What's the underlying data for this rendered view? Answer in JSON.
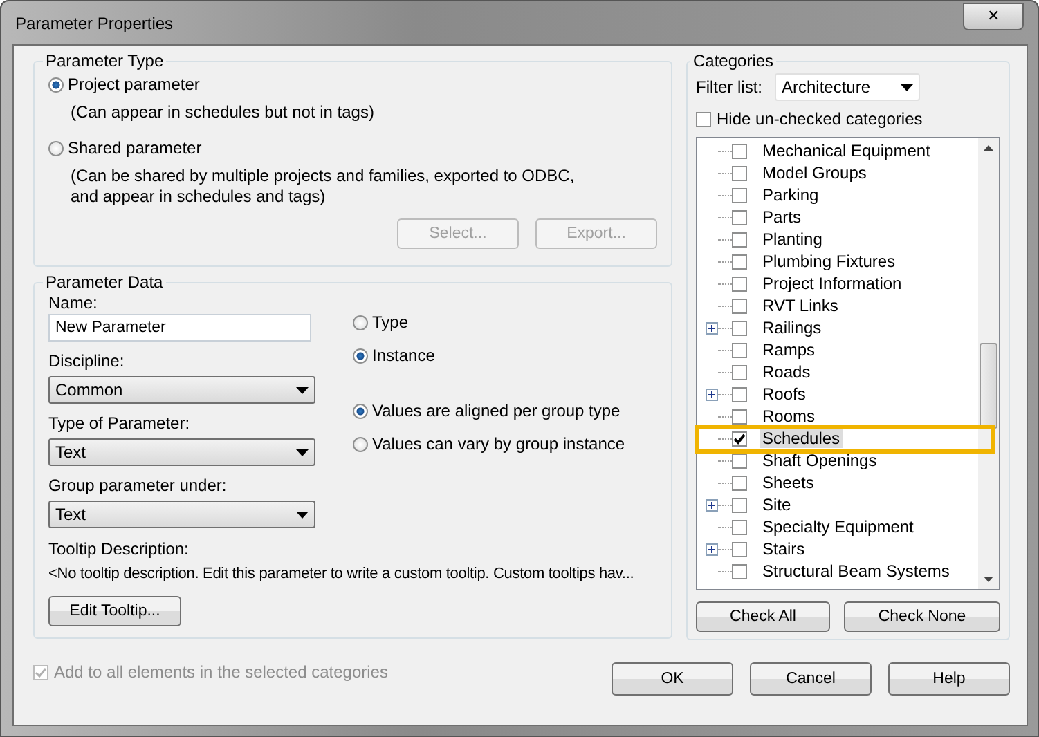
{
  "window": {
    "title": "Parameter Properties",
    "close_button": "✕"
  },
  "parameter_type": {
    "title": "Parameter Type",
    "options": [
      {
        "label": "Project parameter",
        "note": "(Can appear in schedules but not in tags)",
        "selected": true
      },
      {
        "label": "Shared parameter",
        "note": "(Can be shared by multiple projects and families, exported to ODBC, and appear in schedules and tags)",
        "selected": false
      }
    ],
    "buttons": [
      {
        "label": "Select...",
        "disabled": true
      },
      {
        "label": "Export...",
        "disabled": true
      }
    ]
  },
  "parameter_data": {
    "title": "Parameter Data",
    "name_label": "Name:",
    "name_value": "New Parameter",
    "dropdowns": [
      {
        "label": "Discipline:",
        "value": "Common"
      },
      {
        "label": "Type of Parameter:",
        "value": "Text"
      },
      {
        "label": "Group parameter under:",
        "value": "Text"
      }
    ],
    "scope_options": [
      {
        "label": "Type",
        "selected": false
      },
      {
        "label": "Instance",
        "selected": true
      }
    ],
    "group_options": [
      {
        "label": "Values are aligned per group type",
        "selected": true
      },
      {
        "label": "Values can vary by group instance",
        "selected": false
      }
    ],
    "tooltip_label": "Tooltip Description:",
    "tooltip_text": "<No tooltip description. Edit this parameter to write a custom tooltip. Custom tooltips hav...",
    "edit_tooltip_button": "Edit Tooltip..."
  },
  "add_to_all": {
    "label": "Add to all elements in the selected categories",
    "checked": true,
    "disabled": true
  },
  "categories": {
    "title": "Categories",
    "filter_label": "Filter list:",
    "filter_value": "Architecture",
    "hide_unchecked": {
      "label": "Hide un-checked categories",
      "checked": false
    },
    "items": [
      {
        "label": "Mechanical Equipment",
        "checked": false,
        "expandable": false,
        "selected": false
      },
      {
        "label": "Model Groups",
        "checked": false,
        "expandable": false,
        "selected": false
      },
      {
        "label": "Parking",
        "checked": false,
        "expandable": false,
        "selected": false
      },
      {
        "label": "Parts",
        "checked": false,
        "expandable": false,
        "selected": false
      },
      {
        "label": "Planting",
        "checked": false,
        "expandable": false,
        "selected": false
      },
      {
        "label": "Plumbing Fixtures",
        "checked": false,
        "expandable": false,
        "selected": false
      },
      {
        "label": "Project Information",
        "checked": false,
        "expandable": false,
        "selected": false
      },
      {
        "label": "RVT Links",
        "checked": false,
        "expandable": false,
        "selected": false
      },
      {
        "label": "Railings",
        "checked": false,
        "expandable": true,
        "selected": false
      },
      {
        "label": "Ramps",
        "checked": false,
        "expandable": false,
        "selected": false
      },
      {
        "label": "Roads",
        "checked": false,
        "expandable": false,
        "selected": false
      },
      {
        "label": "Roofs",
        "checked": false,
        "expandable": true,
        "selected": false
      },
      {
        "label": "Rooms",
        "checked": false,
        "expandable": false,
        "selected": false
      },
      {
        "label": "Schedules",
        "checked": true,
        "expandable": false,
        "selected": true,
        "highlighted": true
      },
      {
        "label": "Shaft Openings",
        "checked": false,
        "expandable": false,
        "selected": false
      },
      {
        "label": "Sheets",
        "checked": false,
        "expandable": false,
        "selected": false
      },
      {
        "label": "Site",
        "checked": false,
        "expandable": true,
        "selected": false
      },
      {
        "label": "Specialty Equipment",
        "checked": false,
        "expandable": false,
        "selected": false
      },
      {
        "label": "Stairs",
        "checked": false,
        "expandable": true,
        "selected": false
      },
      {
        "label": "Structural Beam Systems",
        "checked": false,
        "expandable": false,
        "selected": false
      }
    ],
    "buttons": [
      "Check All",
      "Check None"
    ]
  },
  "buttons": [
    "OK",
    "Cancel",
    "Help"
  ]
}
